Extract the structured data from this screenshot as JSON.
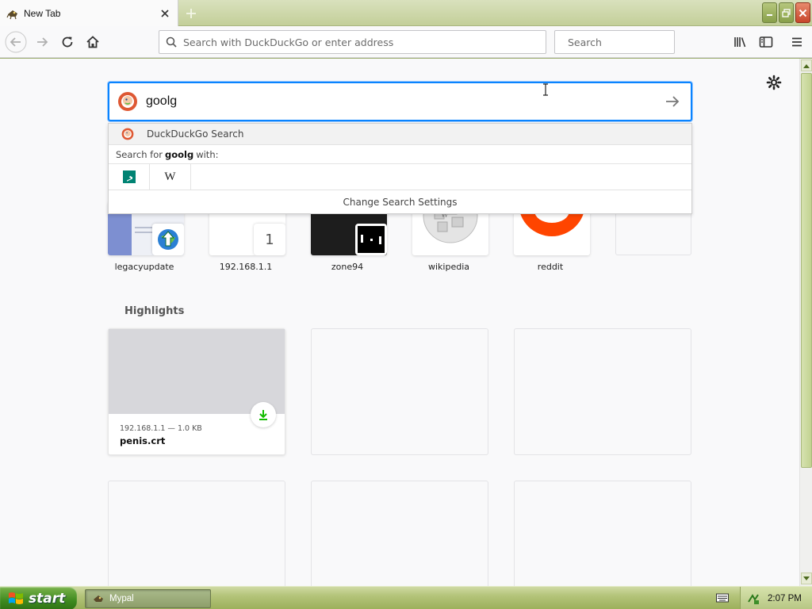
{
  "window": {
    "tab_title": "New Tab",
    "colors": {
      "accent": "#0a84ff",
      "chrome": "#c3cf99"
    }
  },
  "toolbar": {
    "url_placeholder": "Search with DuckDuckGo or enter address",
    "search_placeholder": "Search"
  },
  "newtab": {
    "search_value": "goolg",
    "dropdown": {
      "engine_name": "DuckDuckGo Search",
      "search_for_prefix": "Search for",
      "search_for_term": "goolg",
      "search_for_suffix": "with:",
      "one_off_engines": [
        "bing-icon",
        "wikipedia-icon"
      ],
      "change_settings": "Change Search Settings"
    },
    "top_sites": [
      {
        "label": "legacyupdate",
        "badge": "upload-globe-icon"
      },
      {
        "label": "192.168.1.1",
        "badge_text": "1"
      },
      {
        "label": "zone94",
        "badge": "pong-icon"
      },
      {
        "label": "wikipedia"
      },
      {
        "label": "reddit"
      },
      {
        "label": ""
      }
    ],
    "highlights_title": "Highlights",
    "highlights": [
      {
        "host": "192.168.1.1 — 1.0 KB",
        "title": "penis.crt",
        "icon": "download-icon"
      }
    ]
  },
  "taskbar": {
    "start_label": "start",
    "task_label": "Mypal",
    "clock": "2:07 PM"
  }
}
